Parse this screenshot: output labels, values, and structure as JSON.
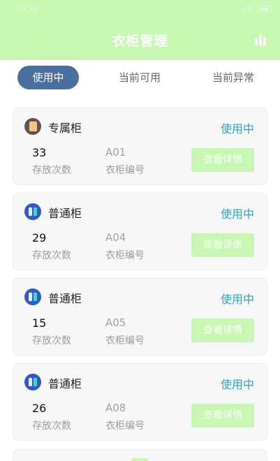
{
  "status_bar": {
    "time": "09:39",
    "signal": "4G",
    "battery": ""
  },
  "header": {
    "title": "衣柜管理",
    "chart_icon": "bar-chart-icon"
  },
  "tabs": [
    {
      "label": "使用中",
      "active": true
    },
    {
      "label": "当前可用",
      "active": false
    },
    {
      "label": "当前异常",
      "active": false
    }
  ],
  "cards": [
    {
      "type": "special",
      "icon": "special-cabinet-icon",
      "name": "专属柜",
      "status": "使用中",
      "count": "33",
      "count_label": "存放次数",
      "cabinet_no": "A01",
      "cabinet_no_label": "衣柜编号",
      "button": "查看详情"
    },
    {
      "type": "normal",
      "icon": "normal-cabinet-icon",
      "name": "普通柜",
      "status": "使用中",
      "count": "29",
      "count_label": "存放次数",
      "cabinet_no": "A04",
      "cabinet_no_label": "衣柜编号",
      "button": "查看详情"
    },
    {
      "type": "normal",
      "icon": "normal-cabinet-icon",
      "name": "普通柜",
      "status": "使用中",
      "count": "15",
      "count_label": "存放次数",
      "cabinet_no": "A05",
      "cabinet_no_label": "衣柜编号",
      "button": "查看详情"
    },
    {
      "type": "normal",
      "icon": "normal-cabinet-icon",
      "name": "普通柜",
      "status": "使用中",
      "count": "26",
      "count_label": "存放次数",
      "cabinet_no": "A08",
      "cabinet_no_label": "衣柜编号",
      "button": "查看详情"
    }
  ],
  "colors": {
    "header_bg": "#c7f7b3",
    "tab_active": "#4a6f9e",
    "status_text": "#21a9c9",
    "button_bg": "#c7f7b3"
  }
}
